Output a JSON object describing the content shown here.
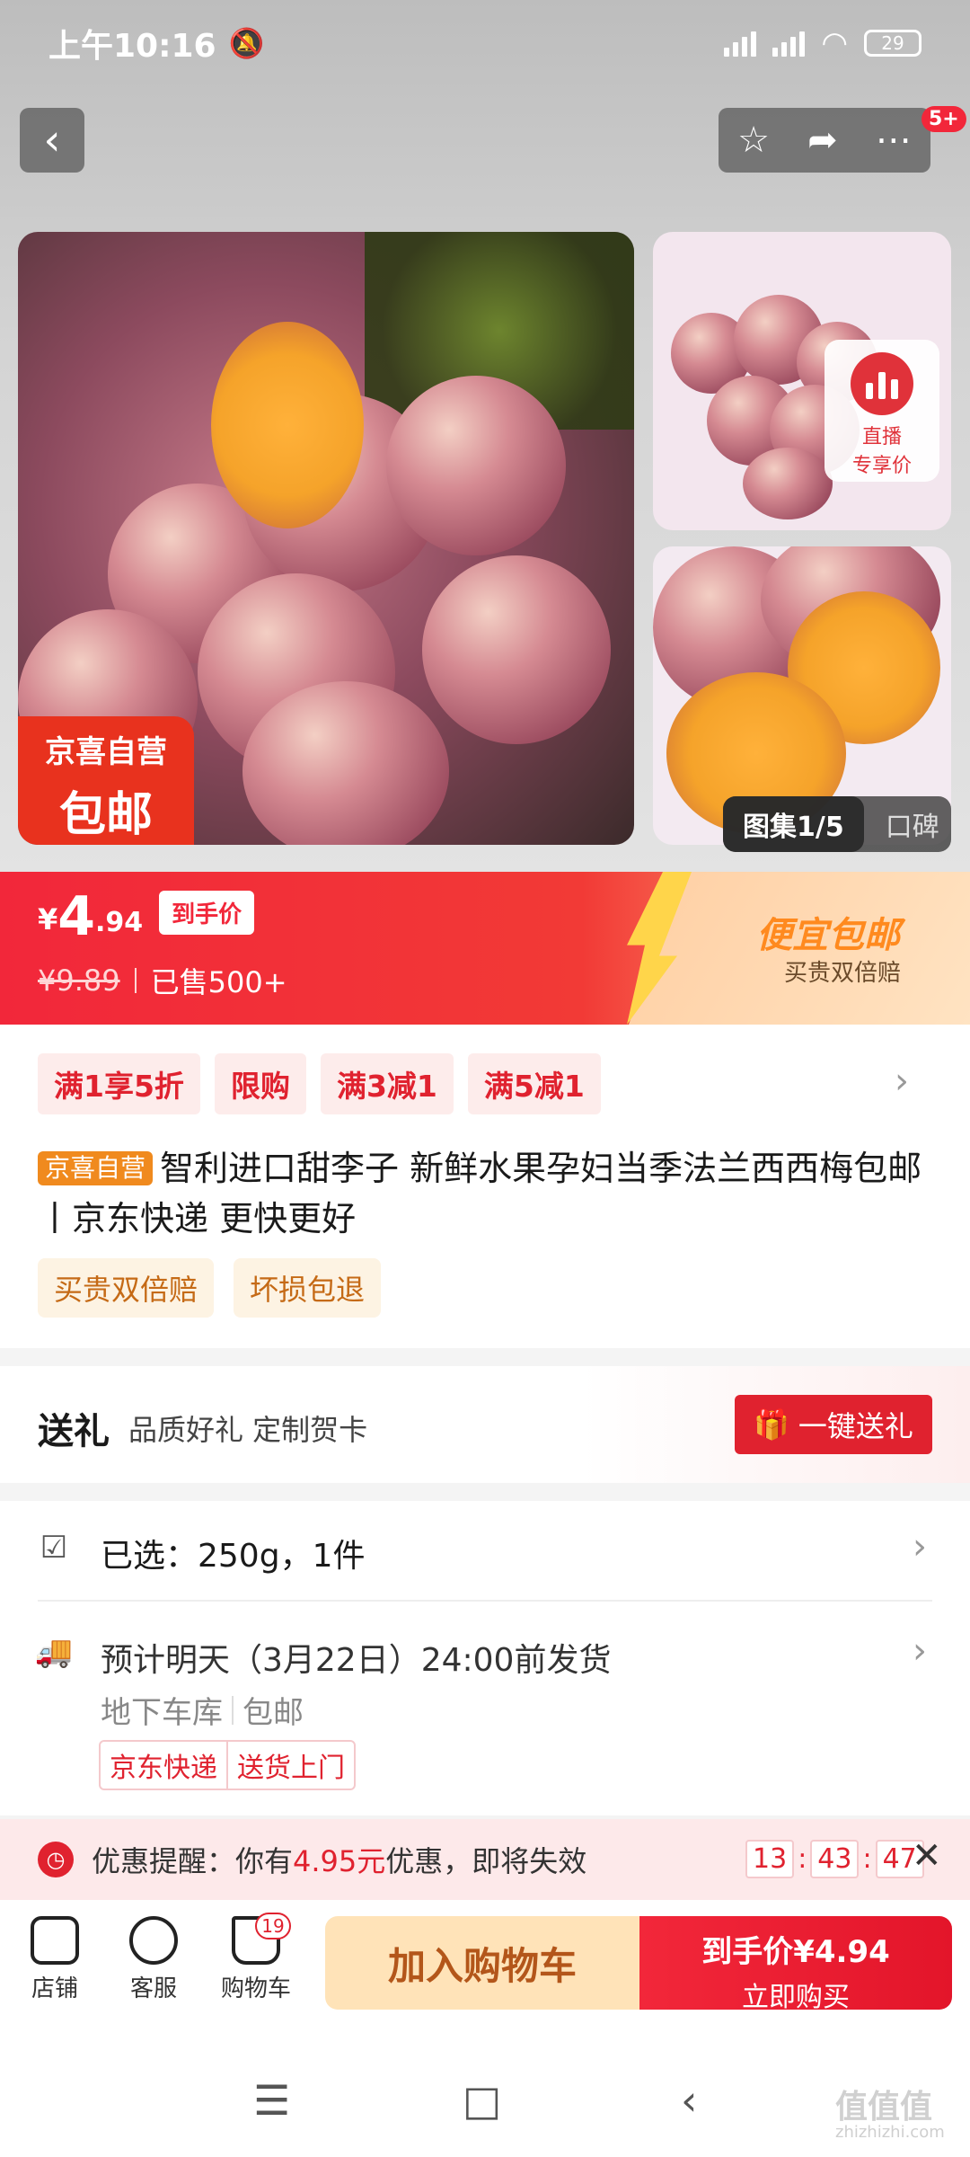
{
  "status_bar": {
    "time": "上午10:16",
    "battery": "29"
  },
  "header": {
    "notification_badge": "5+"
  },
  "gallery": {
    "main_tag_line1": "京喜自营",
    "main_tag_line2": "包邮",
    "live_label_line1": "直播",
    "live_label_line2": "专享价",
    "gallery_counter": "图集1/5",
    "reviews_tab": "口碑"
  },
  "price": {
    "currency": "¥",
    "integer": "4",
    "decimal": ".94",
    "hand_price_label": "到手价",
    "original_price": "¥9.89",
    "sold_count": "已售500+",
    "promo_title": "便宜包邮",
    "promo_sub": "买贵双倍赔"
  },
  "coupons": [
    "满1享5折",
    "限购",
    "满3减1",
    "满5减1"
  ],
  "product": {
    "self_tag": "京喜自营",
    "title": "智利进口甜李子 新鲜水果孕妇当季法兰西西梅包邮丨京东快递 更快更好",
    "features": [
      "买贵双倍赔",
      "坏损包退"
    ]
  },
  "gift": {
    "title": "送礼",
    "subtitle": "品质好礼 定制贺卡",
    "button_label": "一键送礼"
  },
  "selection": {
    "selected": "已选：250g，1件",
    "shipping": "预计明天（3月22日）24:00前发货",
    "warehouse": "地下车库",
    "shipping_fee": "包邮",
    "delivery_tags": [
      "京东快递",
      "送货上门"
    ]
  },
  "reminder": {
    "prefix": "优惠提醒：你有",
    "amount": "4.95元",
    "suffix": "优惠，即将失效",
    "timer": [
      "13",
      "43",
      "47"
    ]
  },
  "bottom_bar": {
    "store_label": "店铺",
    "service_label": "客服",
    "cart_label": "购物车",
    "cart_count": "19",
    "add_cart_label": "加入购物车",
    "buy_line1": "到手价¥4.94",
    "buy_line2": "立即购买"
  },
  "watermark": {
    "logo": "值值值",
    "site": "zhizhizhi.com"
  },
  "colors": {
    "brand_red": "#f2273a",
    "promo_orange": "#ff8a1f"
  }
}
